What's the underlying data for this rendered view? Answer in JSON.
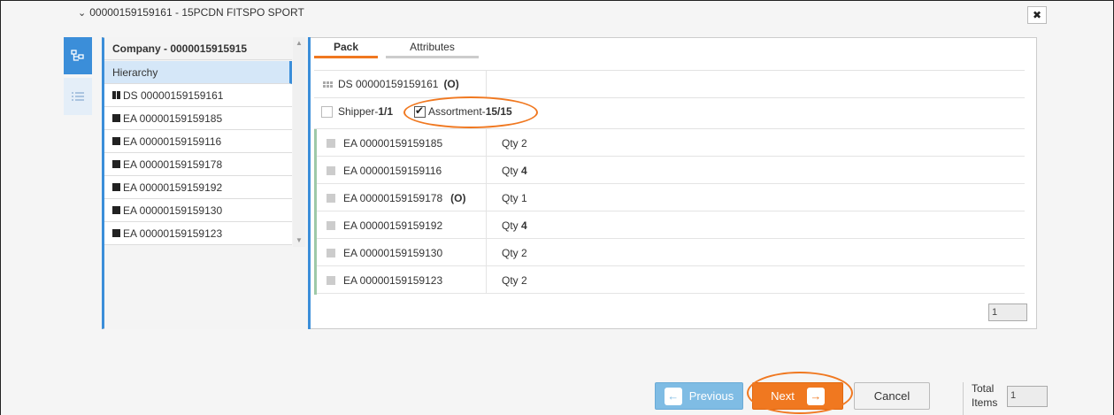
{
  "header": {
    "title": "00000159159161 - 15PCDN FITSPO SPORT",
    "close_label": "✖"
  },
  "tree": {
    "company": "Company - 0000015915915",
    "hierarchy": "Hierarchy",
    "items": [
      "DS 00000159159161",
      "EA 00000159159185",
      "EA 00000159159116",
      "EA 00000159159178",
      "EA 00000159159192",
      "EA 00000159159130",
      "EA 00000159159123"
    ]
  },
  "tabs": {
    "pack": "Pack",
    "attributes": "Attributes"
  },
  "pack": {
    "ds_label": "DS 00000159159161",
    "ds_suffix": "(O)",
    "shipper_label": "Shipper-",
    "shipper_value": "1/1",
    "assortment_label": "Assortment-",
    "assortment_value": "15/15",
    "rows": [
      {
        "code": "EA 00000159159185",
        "suffix": "",
        "qty_label": "Qty",
        "qty": "2"
      },
      {
        "code": "EA 00000159159116",
        "suffix": "",
        "qty_label": "Qty",
        "qty": "4"
      },
      {
        "code": "EA 00000159159178",
        "suffix": "(O)",
        "qty_label": "Qty",
        "qty": "1"
      },
      {
        "code": "EA 00000159159192",
        "suffix": "",
        "qty_label": "Qty",
        "qty": "4"
      },
      {
        "code": "EA 00000159159130",
        "suffix": "",
        "qty_label": "Qty",
        "qty": "2"
      },
      {
        "code": "EA 00000159159123",
        "suffix": "",
        "qty_label": "Qty",
        "qty": "2"
      }
    ],
    "page_value": "1"
  },
  "footer": {
    "previous_label": "Previous",
    "next_label": "Next",
    "cancel_label": "Cancel",
    "total_label_line1": "Total",
    "total_label_line2": "Items",
    "total_value": "1"
  },
  "colors": {
    "accent": "#f07820",
    "blue": "#3b8ed9",
    "prev": "#7fbce4"
  }
}
